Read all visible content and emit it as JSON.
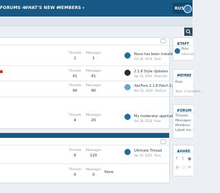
{
  "nav": {
    "forums": "FORUMS",
    "whats_new": "WHAT'S NEW",
    "members": "MEMBERS",
    "user": "RUSS",
    "chevron": "▾"
  },
  "search_icon": "search-icon",
  "sections": [
    {
      "forums": [
        {
          "threads_label": "Threads",
          "threads": "1",
          "messages_label": "Messages",
          "messages": "1",
          "last_title": "Nova has been installed on the f...",
          "last_meta": "Oct 26, 2018 · Russ",
          "avatar_color": "#1c6ea4"
        },
        {
          "threads_label": "Threads",
          "threads": "41",
          "messages_label": "Messages",
          "messages": "41",
          "last_title": "2.1.8 Style Updates",
          "last_meta": "Apr 16, 2020 · Pixel Exit",
          "avatar_color": "#2a2f36"
        },
        {
          "threads_label": "Threads",
          "threads": "90",
          "messages_label": "Messages",
          "messages": "90",
          "last_title": "XenForo 2.1.8 Patch 2, Media Gal...",
          "last_meta": "Mar 25, 2020 · XenForo",
          "avatar_color": "#5fa6d9"
        },
        {
          "threads_label": "Threads",
          "threads": "4",
          "messages_label": "Messages",
          "messages": "20",
          "last_title": "My moderator application",
          "last_meta": "Oct 28, 2018 · Russ",
          "avatar_color": "#1c6ea4"
        }
      ]
    },
    {
      "forums": [
        {
          "threads_label": "Threads",
          "threads": "6",
          "messages_label": "Messages",
          "messages": "120",
          "last_title": "Ultimate Thread",
          "last_meta": "Apr 16, 2020 · Russ",
          "avatar_color": "#1c6ea4"
        },
        {
          "threads_label": "Threads",
          "threads": "0",
          "messages_label": "Messages",
          "messages": "0",
          "last_title": "None",
          "last_meta": "",
          "avatar_color": ""
        }
      ]
    }
  ],
  "sidebar": {
    "staff": {
      "title": "STAFF",
      "name": "Russ",
      "role": "Administ..."
    },
    "members": {
      "title": "MEMBE",
      "name": "Russ",
      "total": "Total: 1 (members..."
    },
    "forum_stats": {
      "title": "FORUM",
      "threads": "Threads:",
      "messages": "Messages:",
      "members": "Members:",
      "latest": "Latest me..."
    },
    "share": {
      "title": "SHARE",
      "icons": [
        "facebook-icon",
        "twitter-icon",
        "reddit-icon",
        "pinterest-icon",
        "whatsapp-icon",
        "link-icon"
      ]
    }
  }
}
